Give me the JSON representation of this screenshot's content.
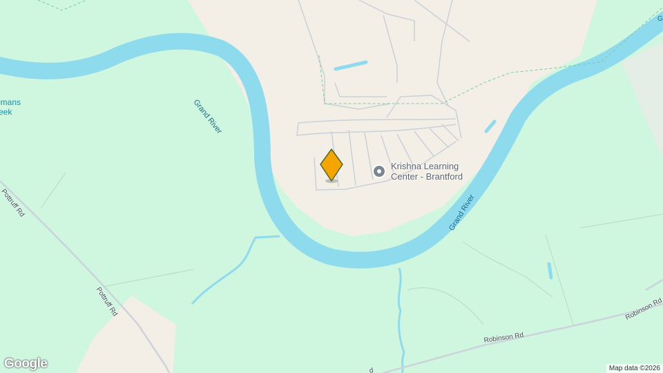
{
  "map": {
    "poi": {
      "name": "Krishna Learning Center - Brantford",
      "line1": "Krishna Learning",
      "line2": "Center - Brantford",
      "icon": "place-pin-icon"
    },
    "marker": {
      "icon": "location-marker-icon",
      "color": "#f5a400"
    },
    "water_labels": {
      "creek": "emans\nreek",
      "river_upper": "Grand River",
      "river_lower": "Grand River",
      "edge": "G"
    },
    "roads": {
      "pottruff_upper": "Pottruff Rd",
      "pottruff_lower": "Pottruff Rd",
      "robinson_mid": "Robinson Rd",
      "robinson_right": "Robinson Rd",
      "bottom_stub": "d"
    },
    "branding": {
      "logo": "Google",
      "attribution": "Map data ©2026"
    },
    "colors": {
      "water": "#8fdbee",
      "park": "#cff6df",
      "urban": "#f3efe6",
      "road": "#cfd3d8"
    }
  }
}
